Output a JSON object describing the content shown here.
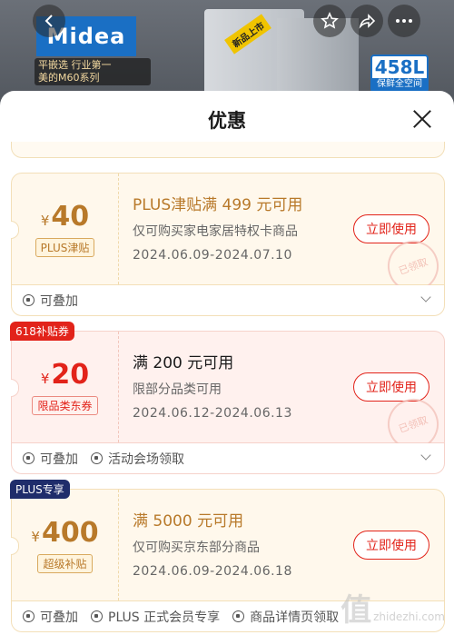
{
  "background": {
    "brand": "Midea",
    "promo_line1": "平嵌选 行业第一",
    "promo_line2": "美的M60系列",
    "new_tag": "新品上市",
    "capacity": "458L",
    "capacity_sub": "保鲜全空间"
  },
  "sheet": {
    "title": "优惠",
    "close_label": "×"
  },
  "coupons": [
    {
      "corner_tag": "",
      "currency": "¥",
      "amount": "40",
      "tag": "PLUS津贴",
      "condition": "PLUS津贴满 499 元可用",
      "scope": "仅可购买家电家居特权卡商品",
      "dates": "2024.06.09-2024.07.10",
      "button": "立即使用",
      "stamp": "已领取",
      "footer": [
        "可叠加"
      ]
    },
    {
      "corner_tag": "618补贴券",
      "currency": "¥",
      "amount": "20",
      "tag": "限品类东券",
      "condition": "满 200 元可用",
      "scope": "限部分品类可用",
      "dates": "2024.06.12-2024.06.13",
      "button": "立即使用",
      "stamp": "已领取",
      "footer": [
        "可叠加",
        "活动会场领取"
      ]
    },
    {
      "corner_tag": "PLUS专享",
      "currency": "¥",
      "amount": "400",
      "tag": "超级补贴",
      "condition": "满 5000 元可用",
      "scope": "仅可购买京东部分商品",
      "dates": "2024.06.09-2024.06.18",
      "button": "立即使用",
      "stamp": "",
      "footer": [
        "可叠加",
        "PLUS 正式会员专享",
        "商品详情页领取"
      ]
    }
  ],
  "watermark": {
    "logo": "值",
    "site": "zhidezhi.com"
  },
  "colors": {
    "accent": "#e2231a",
    "gold": "#b8792a",
    "plus_navy": "#1f2d6b"
  }
}
